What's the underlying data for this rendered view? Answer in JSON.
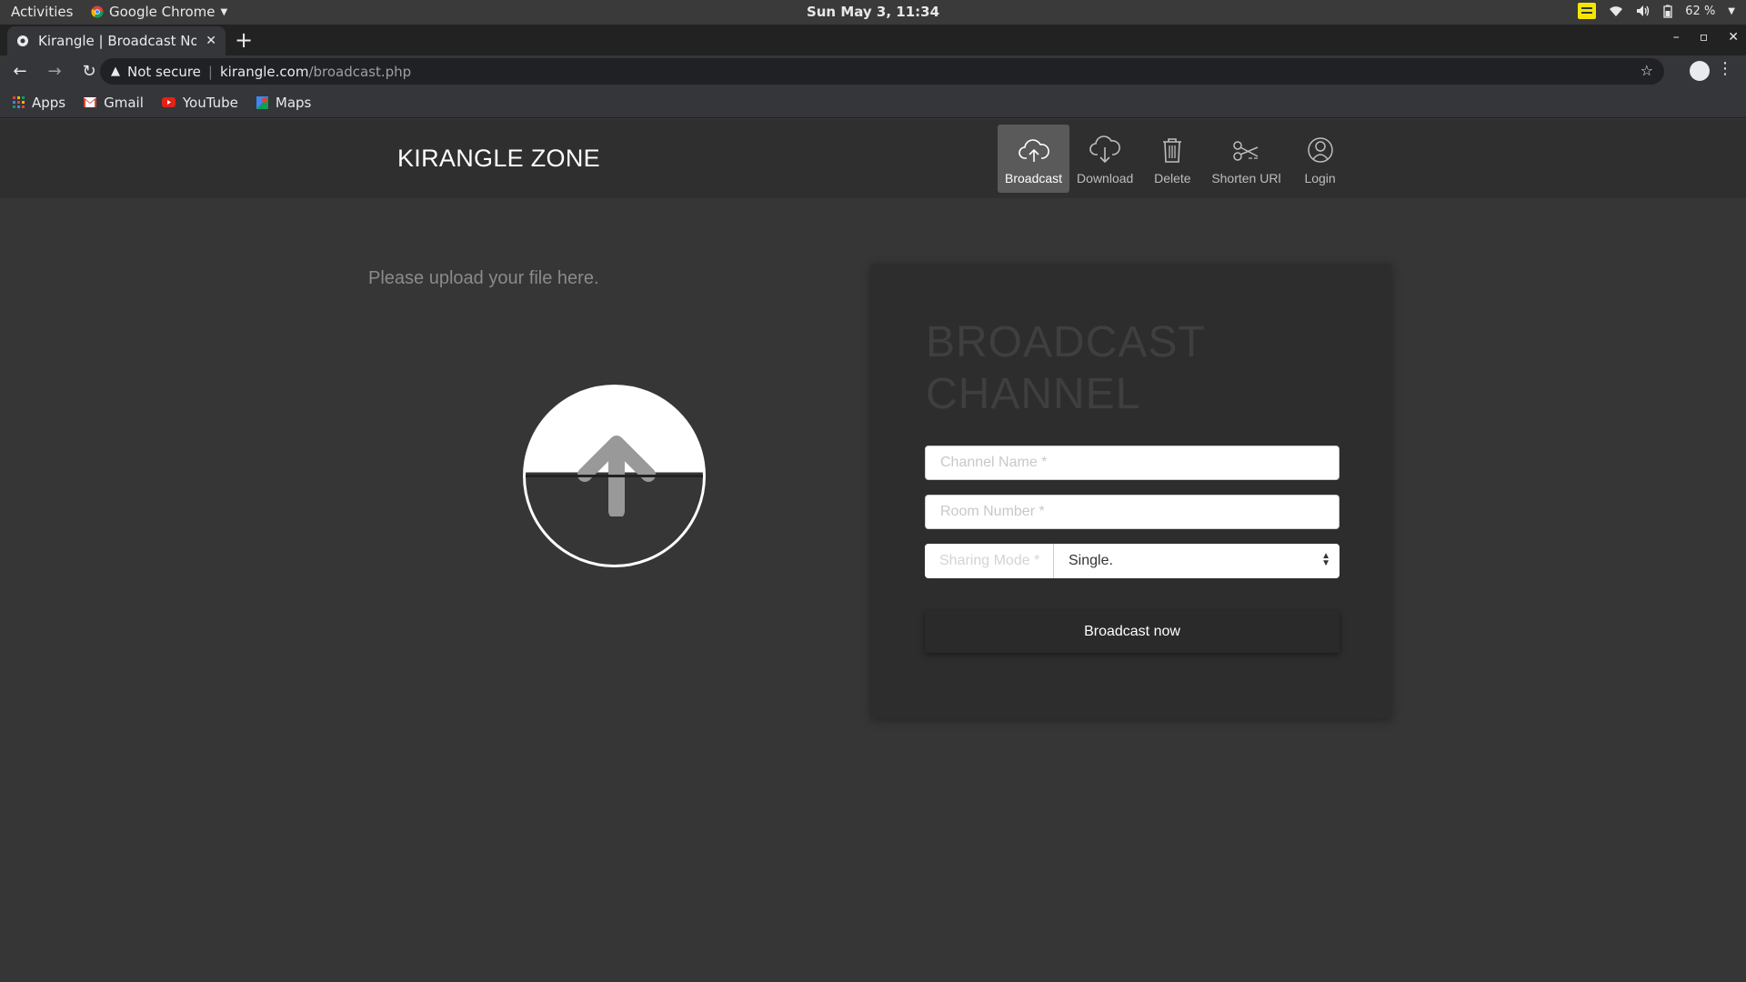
{
  "os_bar": {
    "activities": "Activities",
    "app_name": "Google Chrome",
    "clock": "Sun May  3, 11:34",
    "battery": "62 %"
  },
  "browser": {
    "tab_title": "Kirangle | Broadcast Now",
    "security_label": "Not secure",
    "url_host": "kirangle.com",
    "url_path": "/broadcast.php",
    "bookmarks": [
      "Apps",
      "Gmail",
      "YouTube",
      "Maps"
    ]
  },
  "site": {
    "brand": "KIRANGLE ZONE",
    "nav": [
      {
        "label": "Broadcast",
        "icon": "cloud-upload-icon",
        "active": true
      },
      {
        "label": "Download",
        "icon": "cloud-download-icon",
        "active": false
      },
      {
        "label": "Delete",
        "icon": "trash-icon",
        "active": false
      },
      {
        "label": "Shorten URl",
        "icon": "scissors-icon",
        "active": false
      },
      {
        "label": "Login",
        "icon": "user-icon",
        "active": false
      }
    ]
  },
  "upload": {
    "prompt": "Please upload your file here."
  },
  "form": {
    "title_line1": "BROADCAST",
    "title_line2": "CHANNEL",
    "channel_name_placeholder": "Channel Name *",
    "room_number_placeholder": "Room Number *",
    "sharing_mode_label": "Sharing Mode *",
    "sharing_mode_value": "Single.",
    "submit_label": "Broadcast now"
  }
}
